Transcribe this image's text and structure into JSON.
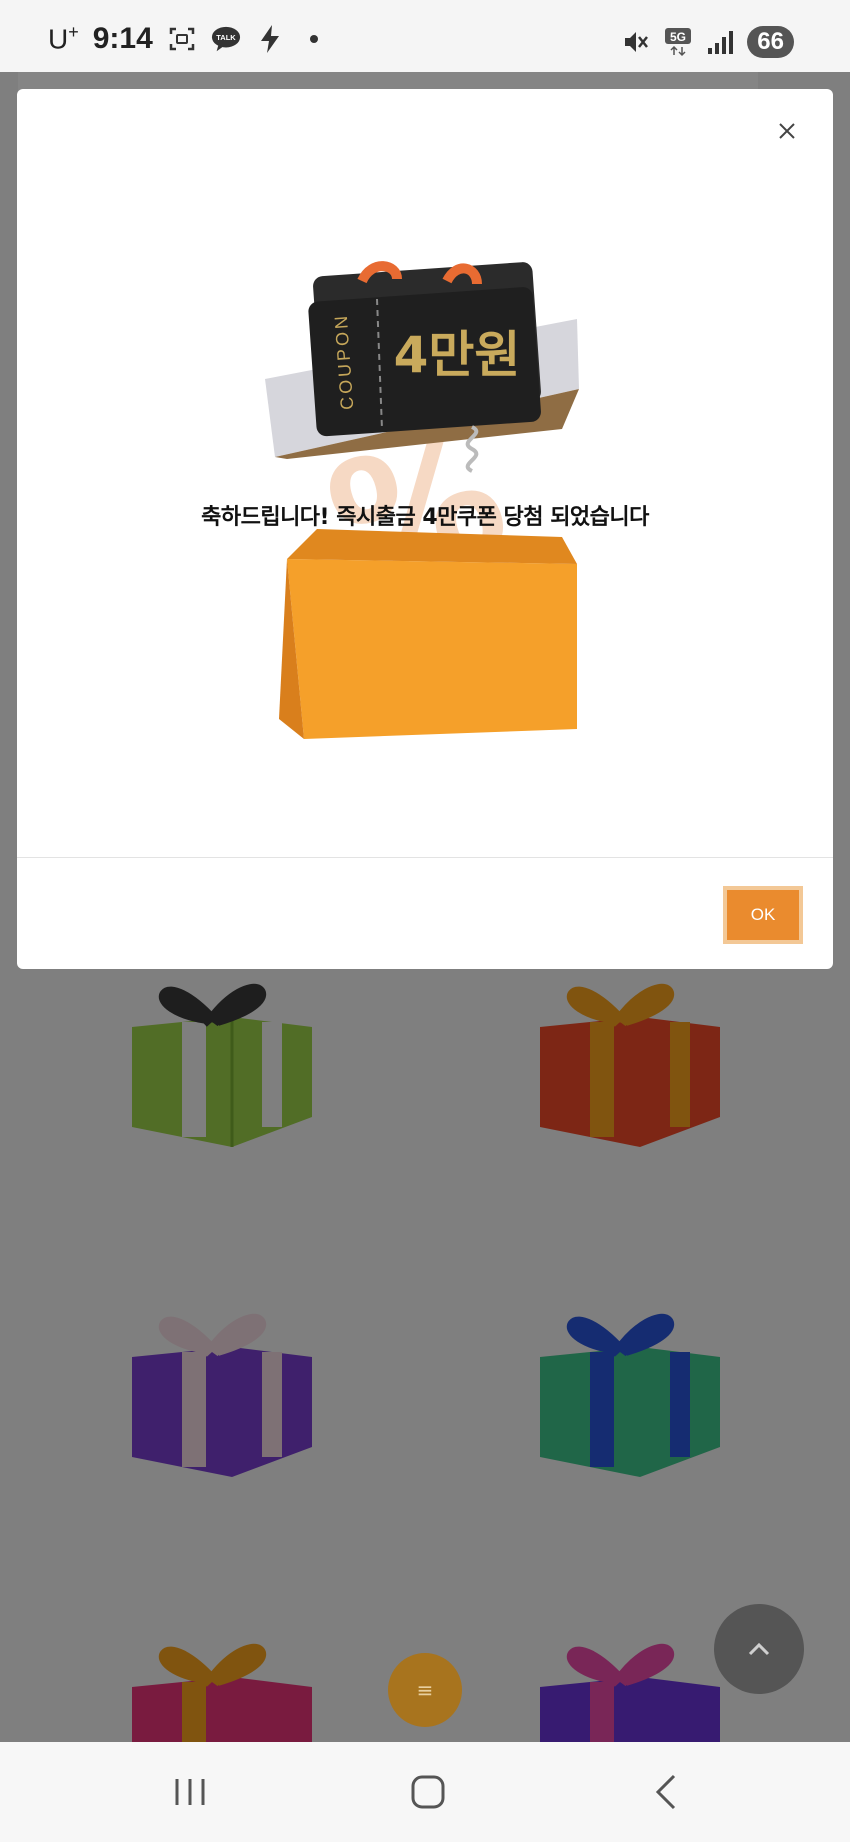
{
  "status_bar": {
    "carrier": "U",
    "carrier_sup": "+",
    "time": "9:14",
    "talk_badge": "TALK",
    "network": "5G",
    "battery": "66"
  },
  "modal": {
    "coupon_label": "COUPON",
    "coupon_amount": "4만원",
    "message": "축하드립니다! 즉시출금 4만쿠폰 당첨 되었습니다",
    "ok_label": "OK"
  },
  "fab": {
    "menu_symbol": "≡"
  },
  "colors": {
    "accent": "#ea8b2e",
    "overlay": "rgba(0,0,0,0.48)"
  }
}
